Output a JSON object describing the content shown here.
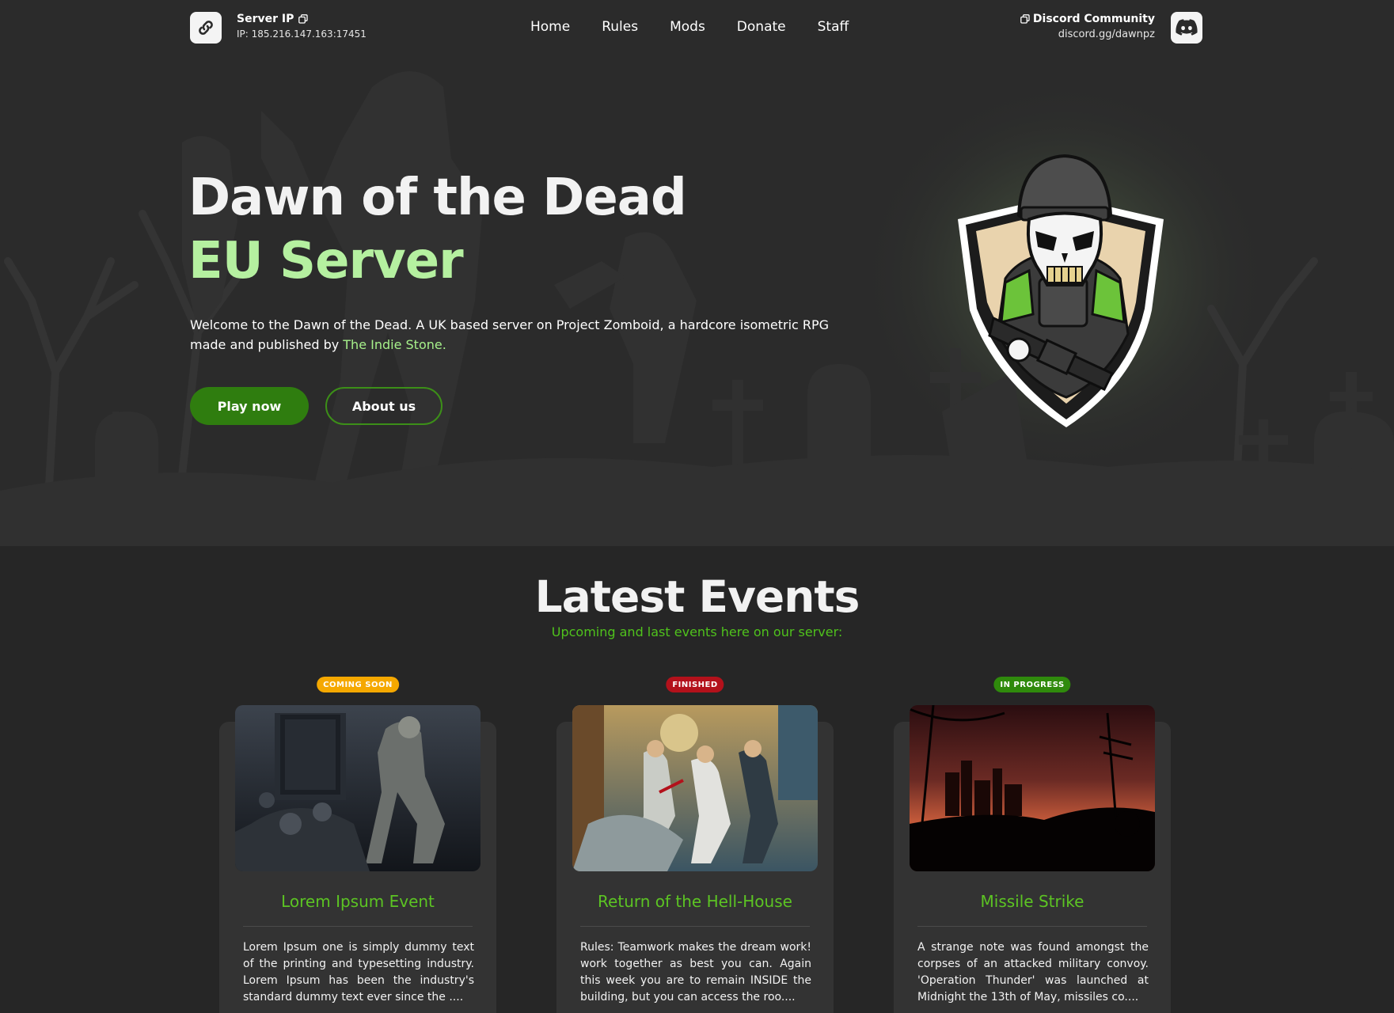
{
  "header": {
    "server_ip_title": "Server IP",
    "server_ip_address": "IP: 185.216.147.163:17451",
    "nav": [
      "Home",
      "Rules",
      "Mods",
      "Donate",
      "Staff"
    ],
    "discord_title": "Discord Community",
    "discord_link": "discord.gg/dawnpz",
    "icons": [
      "link-icon",
      "copy-icon",
      "discord-icon"
    ]
  },
  "hero": {
    "title_line1": "Dawn of the Dead",
    "title_line2": "EU Server",
    "description_part1": "Welcome to the Dawn of the Dead. A UK based server on Project Zomboid, a hardcore isometric RPG made and published by ",
    "description_link": "The Indie Stone",
    "description_end": ".",
    "play_button": "Play now",
    "about_button": "About us"
  },
  "events": {
    "title": "Latest Events",
    "subtitle": "Upcoming and last events here on our server:",
    "items": [
      {
        "badge": "COMING SOON",
        "badge_color": "#f5a800",
        "title": "Lorem Ipsum Event",
        "description": "Lorem Ipsum one is simply dummy text of the printing and typesetting industry. Lorem Ipsum has been the industry's standard dummy text ever since the ...."
      },
      {
        "badge": "FINISHED",
        "badge_color": "#b3111b",
        "title": "Return of the Hell-House",
        "description": "Rules: Teamwork makes the dream work! work together as best you can. Again this week you are to remain INSIDE the building, but you can access the roo...."
      },
      {
        "badge": "IN PROGRESS",
        "badge_color": "#2f8a0c",
        "title": "Missile Strike",
        "description": "A strange note was found amongst the corpses of an attacked military convoy. 'Operation Thunder' was launched at Midnight the 13th of May, missiles co...."
      }
    ]
  },
  "colors": {
    "accent_green": "#4fc21c",
    "hero_green": "#b5f0a0",
    "button_green": "#2f7d0f",
    "background": "#262626"
  }
}
